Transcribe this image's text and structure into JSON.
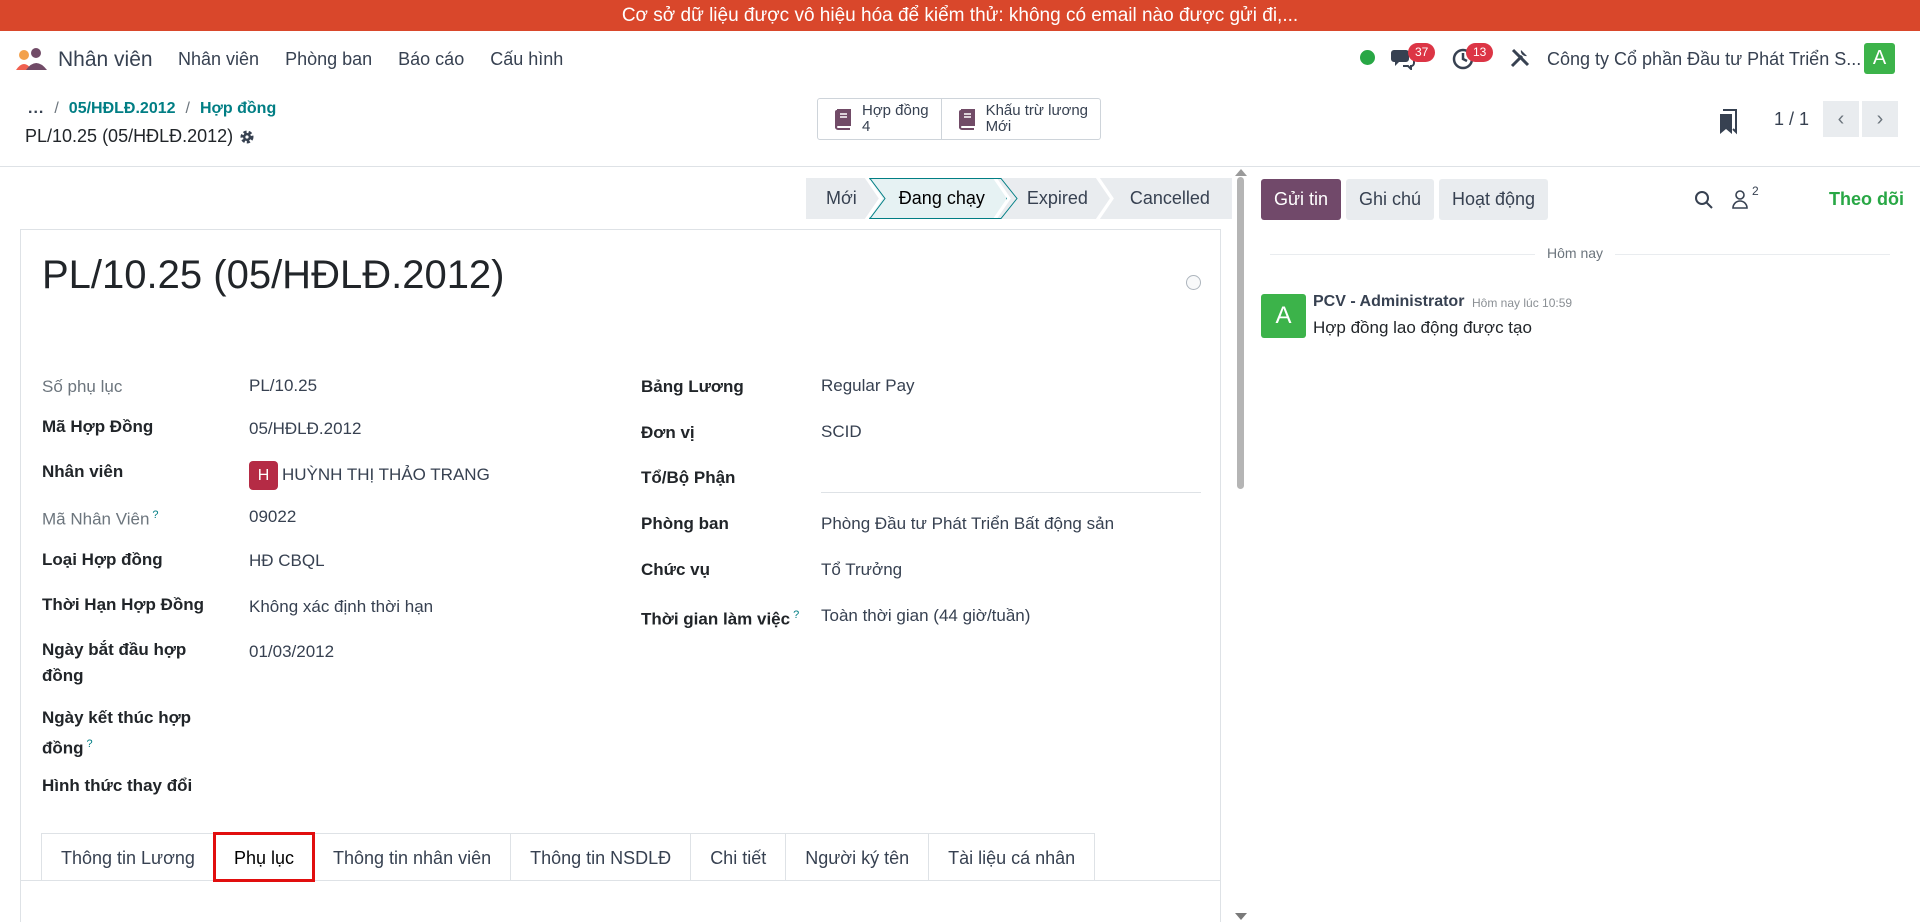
{
  "banner": {
    "text": "Cơ sở dữ liệu được vô hiệu hóa để kiểm thử: không có email nào được gửi đi,..."
  },
  "navbar": {
    "app_name": "Nhân viên",
    "menu": [
      "Nhân viên",
      "Phòng ban",
      "Báo cáo",
      "Cấu hình"
    ],
    "messages_count": "37",
    "activities_count": "13",
    "company": "Công ty Cổ phần Đầu tư Phát Triển S...",
    "user_initial": "A",
    "status_color": "#28a745"
  },
  "breadcrumb": {
    "dots": "...",
    "items": [
      "05/HĐLĐ.2012",
      "Hợp đồng"
    ],
    "current": "PL/10.25 (05/HĐLĐ.2012)"
  },
  "smart_buttons": [
    {
      "label": "Hợp đồng",
      "value": "4",
      "icon": "book-icon"
    },
    {
      "label": "Khấu trừ lương",
      "value": "Mới",
      "icon": "book-icon"
    }
  ],
  "pager": {
    "text": "1 / 1"
  },
  "statusbar": {
    "stages": [
      "Mới",
      "Đang chạy",
      "Expired",
      "Cancelled"
    ],
    "active": "Đang chạy"
  },
  "form": {
    "title": "PL/10.25 (05/HĐLĐ.2012)",
    "left": {
      "so_phu_luc": {
        "label": "Số phụ lục",
        "value": "PL/10.25"
      },
      "ma_hop_dong": {
        "label": "Mã Hợp Đồng",
        "value": "05/HĐLĐ.2012"
      },
      "nhan_vien": {
        "label": "Nhân viên",
        "value": "HUỲNH THỊ THẢO TRANG",
        "avatar": "H"
      },
      "ma_nhan_vien": {
        "label": "Mã Nhân Viên",
        "value": "09022",
        "help": "?"
      },
      "loai_hop_dong": {
        "label": "Loại Hợp đồng",
        "value": "HĐ CBQL"
      },
      "thoi_han": {
        "label": "Thời Hạn Hợp Đồng",
        "value": "Không xác định thời hạn"
      },
      "ngay_bat_dau": {
        "label_1": "Ngày bắt đầu hợp",
        "label_2": "đồng",
        "value": "01/03/2012"
      },
      "ngay_ket_thuc": {
        "label_1": "Ngày kết thúc hợp",
        "label_2": "đồng",
        "help": "?"
      },
      "hinh_thuc": {
        "label": "Hình thức thay đổi"
      }
    },
    "right": {
      "bang_luong": {
        "label": "Bảng Lương",
        "value": "Regular Pay"
      },
      "don_vi": {
        "label": "Đơn vị",
        "value": "SCID"
      },
      "to_bo_phan": {
        "label": "Tổ/Bộ Phận"
      },
      "phong_ban": {
        "label": "Phòng ban",
        "value": "Phòng Đầu tư Phát Triển Bất động sản"
      },
      "chuc_vu": {
        "label": "Chức vụ",
        "value": "Tổ Trưởng"
      },
      "thoi_gian": {
        "label": "Thời gian làm việc",
        "value": "Toàn thời gian (44 giờ/tuần)",
        "help": "?"
      }
    },
    "tabs": [
      "Thông tin Lương",
      "Phụ lục",
      "Thông tin nhân viên",
      "Thông tin NSDLĐ",
      "Chi tiết",
      "Người ký tên",
      "Tài liệu cá nhân"
    ],
    "highlighted_tab": "Phụ lục",
    "highlight_color": "#e10e0e"
  },
  "chatter": {
    "send_message": "Gửi tin",
    "log_note": "Ghi chú",
    "activities": "Hoạt động",
    "followers_count": "2",
    "follow": "Theo dõi",
    "today": "Hôm nay",
    "message": {
      "author": "PCV - Administrator",
      "time": "Hôm nay lúc 10:59",
      "body": "Hợp đồng lao động được tạo",
      "avatar": "A"
    }
  }
}
